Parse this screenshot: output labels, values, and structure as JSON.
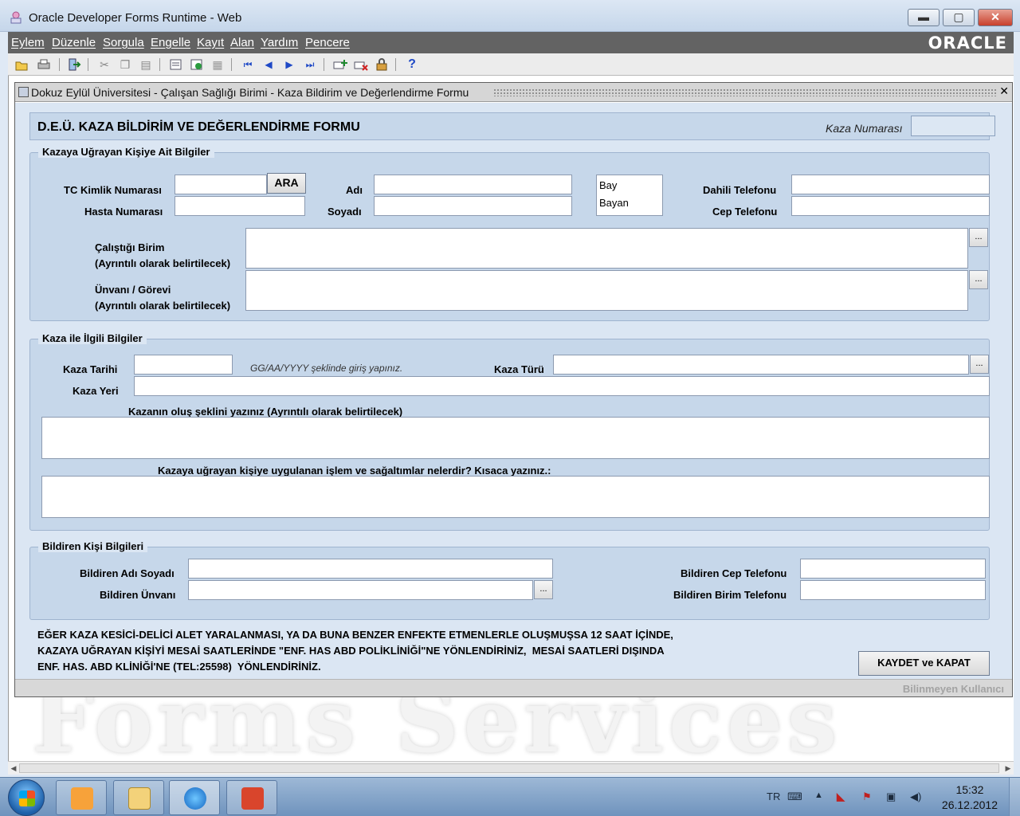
{
  "window": {
    "title": "Oracle Developer Forms Runtime - Web",
    "min_glyph": "▬",
    "max_glyph": "▢",
    "close_glyph": "✕"
  },
  "menu": {
    "items": [
      "Eylem",
      "Düzenle",
      "Sorgula",
      "Engelle",
      "Kayıt",
      "Alan",
      "Yardım",
      "Pencere"
    ],
    "logo": "ORACLE"
  },
  "toolbar": {
    "help_glyph": "?"
  },
  "form_window": {
    "title": "Dokuz Eylül Üniversitesi - Çalışan Sağlığı Birimi - Kaza Bildirim ve Değerlendirme Formu",
    "close_glyph": "✕"
  },
  "header": {
    "form_title": "D.E.Ü. KAZA BİLDİRİM VE DEĞERLENDİRME FORMU",
    "accident_no_label": "Kaza Numarası",
    "accident_no_value": ""
  },
  "person": {
    "legend": "Kazaya Uğrayan Kişiye Ait Bilgiler",
    "tc_label": "TC Kimlik Numarası",
    "tc_value": "",
    "search_button": "ARA",
    "patient_no_label": "Hasta Numarası",
    "patient_no_value": "",
    "name_label": "Adı",
    "name_value": "",
    "surname_label": "Soyadı",
    "surname_value": "",
    "gender_options": [
      "Bay",
      "Bayan"
    ],
    "internal_phone_label": "Dahili Telefonu",
    "internal_phone_value": "",
    "mobile_label": "Cep Telefonu",
    "mobile_value": "",
    "unit_label_1": "Çalıştığı Birim",
    "unit_label_2": "(Ayrıntılı olarak belirtilecek)",
    "unit_value": "",
    "title_label_1": "Ünvanı / Görevi",
    "title_label_2": "(Ayrıntılı olarak belirtilecek)",
    "title_value": "",
    "lov_glyph": "..."
  },
  "accident": {
    "legend": "Kaza ile İlgili Bilgiler",
    "date_label": "Kaza Tarihi",
    "date_value": "",
    "date_hint": "GG/AA/YYYY şeklinde giriş yapınız.",
    "type_label": "Kaza Türü",
    "type_value": "",
    "place_label": "Kaza Yeri",
    "place_value": "",
    "how_label": "Kazanın oluş şeklini yazınız (Ayrıntılı olarak belirtilecek)",
    "how_value": "",
    "treatment_label": "Kazaya uğrayan kişiye uygulanan işlem ve sağaltımlar nelerdir? Kısaca yazınız.:",
    "treatment_value": ""
  },
  "reporter": {
    "legend": "Bildiren Kişi Bilgileri",
    "name_label": "Bildiren Adı Soyadı",
    "name_value": "",
    "title_label": "Bildiren Ünvanı",
    "title_value": "",
    "mobile_label": "Bildiren Cep Telefonu",
    "mobile_value": "",
    "unit_phone_label": "Bildiren Birim Telefonu",
    "unit_phone_value": ""
  },
  "notice": "EĞER KAZA KESİCİ-DELİCİ ALET YARALANMASI, YA DA BUNA BENZER ENFEKTE ETMENLERLE OLUŞMUŞSA 12 SAAT İÇİNDE,\nKAZAYA UĞRAYAN KİŞİYİ MESAİ SAATLERİNDE \"ENF. HAS ABD POLİKLİNİĞİ\"NE YÖNLENDİRİNİZ,  MESAİ SAATLERİ DIŞINDA\nENF. HAS. ABD KLİNİĞİ'NE (TEL:25598)  YÖNLENDİRİNİZ.",
  "save_button": "KAYDET ve KAPAT",
  "status_user": "Bilinmeyen Kullanıcı",
  "watermark": "Forms Services",
  "taskbar": {
    "lang": "TR",
    "time": "15:32",
    "date": "26.12.2012"
  }
}
